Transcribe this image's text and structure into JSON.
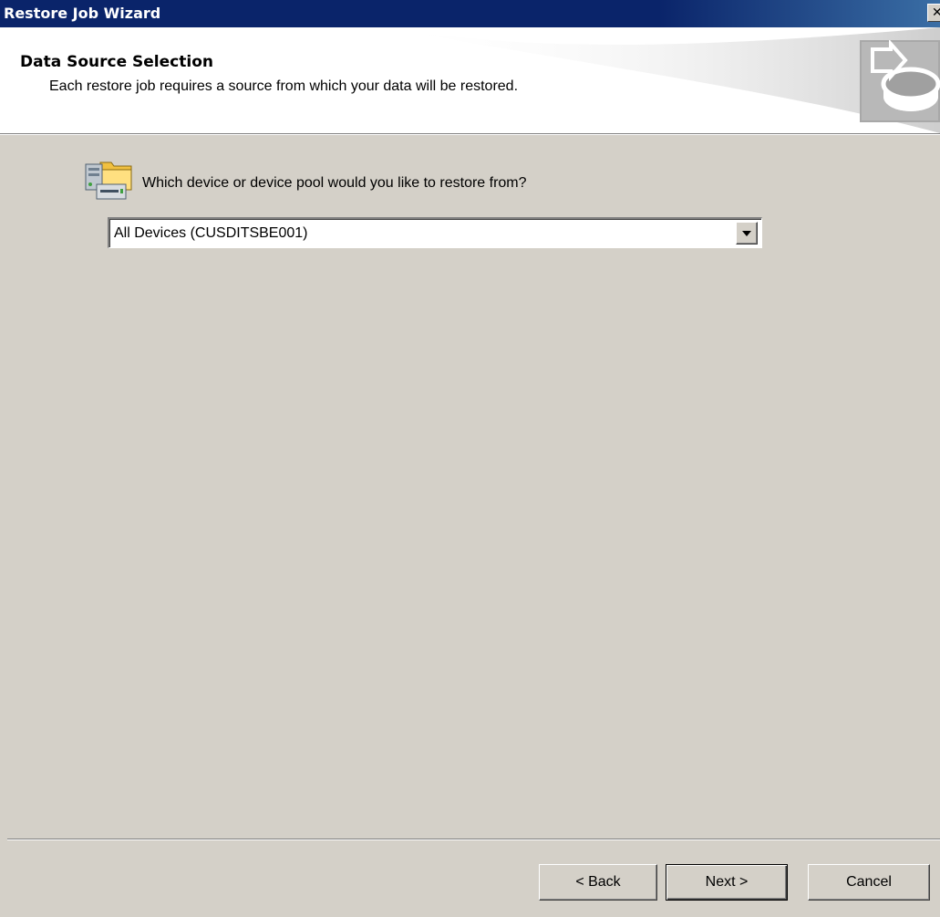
{
  "window": {
    "title": "Restore Job Wizard",
    "close_glyph": "✕"
  },
  "header": {
    "heading": "Data Source Selection",
    "subheading": "Each restore job requires a source from which your data will be restored.",
    "logo_icon": "wizard-disk-icon"
  },
  "content": {
    "question_icon": "device-pool-icon",
    "question": "Which device or device pool would you like to restore from?",
    "device_select": {
      "value": "All Devices (CUSDITSBE001)"
    }
  },
  "footer": {
    "back_label": "< Back",
    "next_label": "Next >",
    "cancel_label": "Cancel"
  },
  "colors": {
    "titlebar": "#0a246a",
    "dialog_face": "#d4d0c8",
    "header_bg": "#ffffff"
  }
}
